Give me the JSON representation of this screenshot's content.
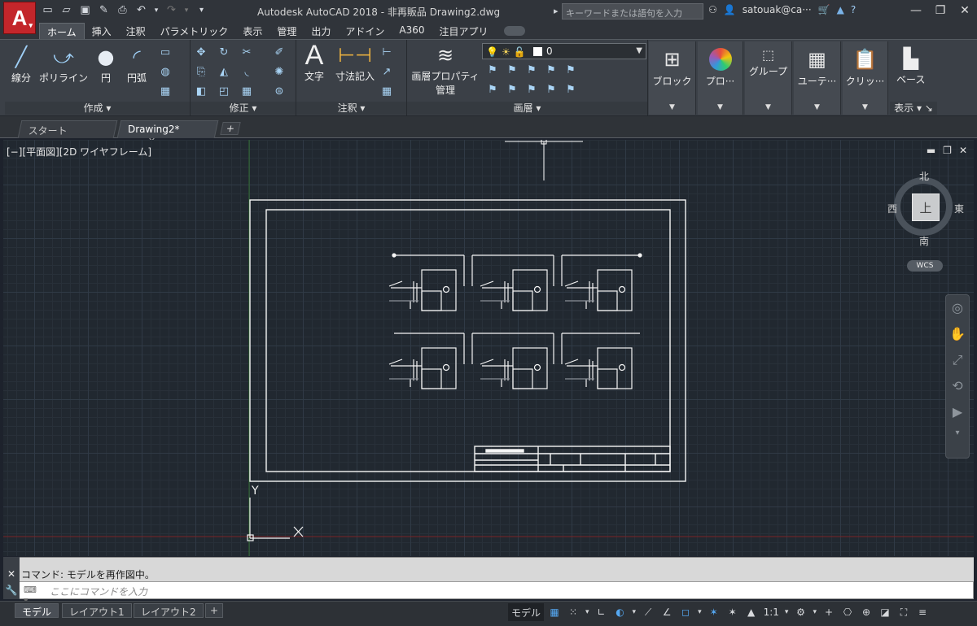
{
  "window": {
    "title": "Autodesk AutoCAD 2018 - 非再販品    Drawing2.dwg",
    "search_placeholder": "キーワードまたは語句を入力",
    "user": "satouak@ca···",
    "app_letter": "A"
  },
  "ribbon_tabs": [
    "ホーム",
    "挿入",
    "注釈",
    "パラメトリック",
    "表示",
    "管理",
    "出力",
    "アドイン",
    "A360",
    "注目アプリ"
  ],
  "ribbon": {
    "draw": {
      "label": "作成",
      "line": "線分",
      "polyline": "ポリライン",
      "circle": "円",
      "arc": "円弧"
    },
    "modify": {
      "label": "修正"
    },
    "annotation": {
      "label": "注釈",
      "text": "文字",
      "dimension": "寸法記入"
    },
    "layers": {
      "label": "画層",
      "properties": "画層プロパティ",
      "properties2": "管理",
      "current_layer": "0"
    },
    "block": "ブロック",
    "properties": "プロ···",
    "groups": "グループ",
    "utilities": "ユーテ···",
    "clipboard": "クリッ···",
    "view": {
      "base": "ベース",
      "label": "表示"
    }
  },
  "file_tabs": {
    "start": "スタート",
    "drawing": "Drawing2*"
  },
  "viewport": {
    "label": "[−][平面図][2D ワイヤフレーム]",
    "compass": {
      "north": "北",
      "south": "南",
      "east": "東",
      "west": "西",
      "top": "上",
      "wcs": "WCS"
    },
    "ucs": {
      "x": "X",
      "y": "Y"
    }
  },
  "command": {
    "history": "コマンド:   モデルを再作図中。",
    "placeholder": "ここにコマンドを入力"
  },
  "layout_tabs": [
    "モデル",
    "レイアウト1",
    "レイアウト2"
  ],
  "status": {
    "model": "モデル",
    "scale": "1:1"
  }
}
